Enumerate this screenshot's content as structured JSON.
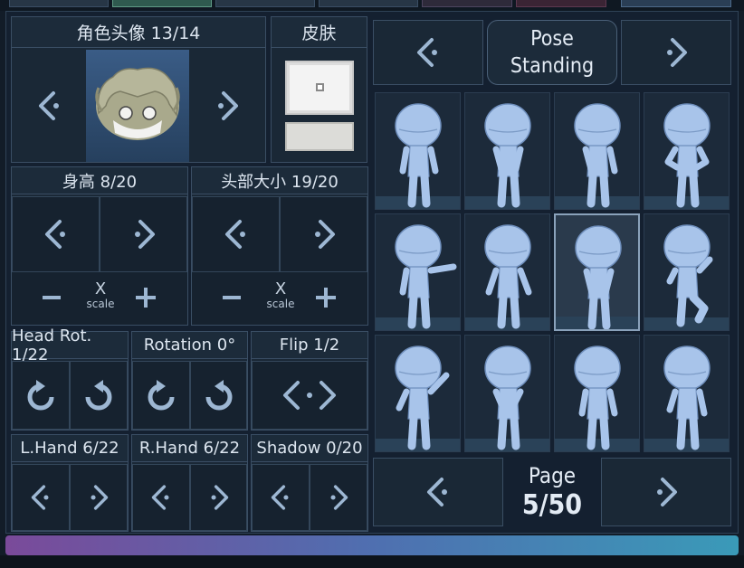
{
  "avatar": {
    "title": "角色头像 13/14"
  },
  "skin": {
    "title": "皮肤"
  },
  "pose": {
    "line1": "Pose",
    "line2": "Standing"
  },
  "height": {
    "title": "身高 8/20",
    "x_label": "X",
    "scale_label": "scale"
  },
  "head_size": {
    "title": "头部大小 19/20",
    "x_label": "X",
    "scale_label": "scale"
  },
  "head_rot": {
    "title": "Head Rot. 1/22"
  },
  "rotation": {
    "title": "Rotation 0°"
  },
  "flip": {
    "title": "Flip 1/2"
  },
  "lhand": {
    "title": "L.Hand 6/22"
  },
  "rhand": {
    "title": "R.Hand 6/22"
  },
  "shadow": {
    "title": "Shadow 0/20"
  },
  "page": {
    "label": "Page",
    "value": "5/50"
  },
  "poses": {
    "selected_index": 6,
    "count": 12
  },
  "colors": {
    "accent": "#9db7d3",
    "panel": "#1a2836",
    "figure": "#a8c4ea"
  }
}
